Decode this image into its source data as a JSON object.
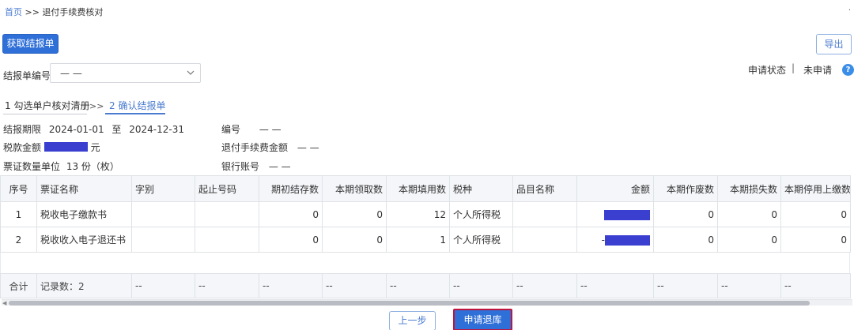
{
  "breadcrumb": {
    "home": "首页",
    "sep": ">>",
    "current": "退付手续费核对"
  },
  "corner_mark": "·",
  "toolbar": {
    "fetch_label": "获取结报单",
    "export_label": "导出"
  },
  "report_no": {
    "label": "结报单编号",
    "value": "— —"
  },
  "status": {
    "label": "申请状态",
    "sep": "|",
    "value": "未申请"
  },
  "help": "?",
  "steps": {
    "step1": "1 勾选单户核对清册",
    "sep": ">>",
    "step2": "2 确认结报单"
  },
  "info": {
    "period_label": "结报期限",
    "period_from": "2024-01-01",
    "period_to_word": "至",
    "period_to": "2024-12-31",
    "number_label": "编号",
    "number_value": "— —",
    "tax_amount_label": "税款金额",
    "tax_amount_unit": "元",
    "fee_label": "退付手续费金额",
    "fee_value": "— —",
    "ticket_qty_label": "票证数量单位",
    "ticket_qty_value": "13 份（枚）",
    "bank_label": "银行账号",
    "bank_value": "— —"
  },
  "table": {
    "headers": [
      "序号",
      "票证名称",
      "字别",
      "起止号码",
      "期初结存数",
      "本期领取数",
      "本期填用数",
      "税种",
      "品目名称",
      "金额",
      "本期作废数",
      "本期损失数",
      "本期停用上缴数"
    ],
    "rows": [
      {
        "seq": "1",
        "name": "税收电子缴款书",
        "zibie": "",
        "range": "",
        "opening": "0",
        "received": "0",
        "used": "12",
        "tax_type": "个人所得税",
        "item": "",
        "amount_prefix": "",
        "voided": "0",
        "lost": "0",
        "stopped": "0"
      },
      {
        "seq": "2",
        "name": "税收收入电子退还书",
        "zibie": "",
        "range": "",
        "opening": "0",
        "received": "0",
        "used": "1",
        "tax_type": "个人所得税",
        "item": "",
        "amount_prefix": "-",
        "voided": "0",
        "lost": "0",
        "stopped": "0"
      }
    ],
    "summary": {
      "label": "合计",
      "count": "记录数：2",
      "dash": "--"
    }
  },
  "footer": {
    "prev_label": "上一步",
    "apply_label": "申请退库"
  },
  "colors": {
    "primary": "#2f6fd8",
    "link": "#4a7bd0",
    "redaction": "#3a3fd0",
    "highlight": "#c0143c"
  }
}
